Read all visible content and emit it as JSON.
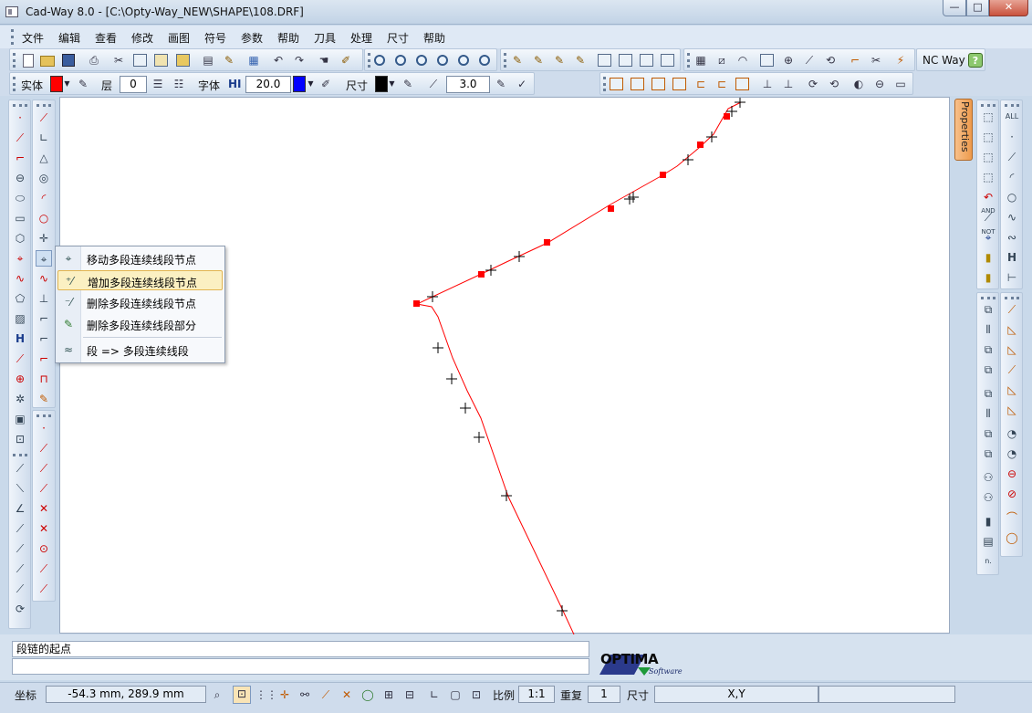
{
  "window": {
    "title": "Cad-Way 8.0 - [C:\\Opty-Way_NEW\\SHAPE\\108.DRF]",
    "min": "—",
    "max": "□",
    "close": "✕"
  },
  "menu": [
    "文件",
    "编辑",
    "查看",
    "修改",
    "画图",
    "符号",
    "参数",
    "帮助",
    "刀具",
    "处理",
    "尺寸",
    "帮助"
  ],
  "toolbar1": {
    "ncway_label": "NC Way",
    "help": "?"
  },
  "toolbar2": {
    "entity_label": "实体",
    "entity_color": "#ff0000",
    "layer_label": "层",
    "layer_value": "0",
    "font_label": "字体",
    "font_hi": "HI",
    "font_height": "20.0",
    "font_color": "#0000ff",
    "dim_label": "尺寸",
    "dim_color": "#000000",
    "dim_value": "3.0"
  },
  "properties_tab": "Properties",
  "context_menu": [
    {
      "label": "移动多段连续线段节点",
      "icon": "move-node-icon"
    },
    {
      "label": "增加多段连续线段节点",
      "icon": "add-node-icon"
    },
    {
      "label": "删除多段连续线段节点",
      "icon": "delete-node-icon"
    },
    {
      "label": "删除多段连续线段部分",
      "icon": "delete-part-icon"
    },
    {
      "label": "段 => 多段连续线段",
      "icon": "segment-to-polyline-icon"
    }
  ],
  "right_toolbar_labels": {
    "all": "ALL",
    "and": "AND",
    "not": "NOT",
    "h": "H"
  },
  "drawing": {
    "polyline_color": "#ff0000",
    "marker_color": "#000000"
  },
  "command": {
    "prompt": "段链的起点",
    "input": ""
  },
  "logo": {
    "name": "OPTIMA",
    "sub": "Software"
  },
  "status": {
    "coord_label": "坐标",
    "coord_value": "-54.3 mm, 289.9 mm",
    "scale_label": "比例",
    "scale_value": "1:1",
    "repeat_label": "重复",
    "repeat_value": "1",
    "dim_label": "尺寸",
    "xy_value": "X,Y"
  }
}
